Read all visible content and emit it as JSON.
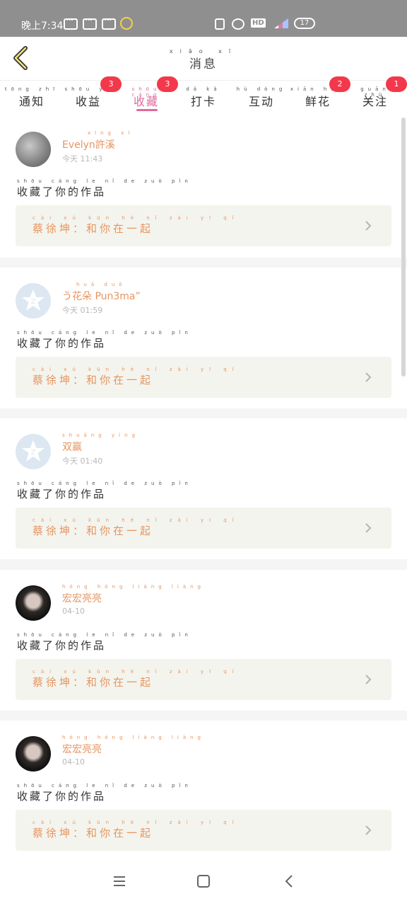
{
  "status_bar": {
    "time": "晚上7:34",
    "hd": "HD",
    "battery": "17"
  },
  "header": {
    "title_pinyin": "xiāo xī",
    "title": "消息"
  },
  "tabs": [
    {
      "pinyin": "tōng zhī",
      "label": "通知",
      "badge": ""
    },
    {
      "pinyin": "shōu yì",
      "label": "收益",
      "badge": "3"
    },
    {
      "pinyin": "shōu cáng",
      "label": "收藏",
      "badge": "3"
    },
    {
      "pinyin": "dǎ kǎ",
      "label": "打卡",
      "badge": ""
    },
    {
      "pinyin": "hù dòng",
      "label": "互动",
      "badge": ""
    },
    {
      "pinyin": "xiān huā",
      "label": "鲜花",
      "badge": "2"
    },
    {
      "pinyin": "guān zhù",
      "label": "关注",
      "badge": "1"
    }
  ],
  "messages": [
    {
      "name_pinyin": "xīng xī",
      "name": "Evelyn許溪",
      "time": "今天 11:43",
      "action_pinyin": "shōu cáng le nǐ de zuò pǐn",
      "action": "收藏了你的作品",
      "work_pinyin": "cài xú kūn hé nǐ zài yī qǐ",
      "work": "蔡徐坤：和你在一起"
    },
    {
      "name_pinyin": "huā duǒ",
      "name": "う花朵 Pun3ma”",
      "time": "今天 01:59",
      "action_pinyin": "shōu cáng le nǐ de zuò pǐn",
      "action": "收藏了你的作品",
      "work_pinyin": "cài xú kūn hé nǐ zài yī qǐ",
      "work": "蔡徐坤：和你在一起"
    },
    {
      "name_pinyin": "shuāng yíng",
      "name": "双赢",
      "time": "今天 01:40",
      "action_pinyin": "shōu cáng le nǐ de zuò pǐn",
      "action": "收藏了你的作品",
      "work_pinyin": "cài xú kūn hé nǐ zài yī qǐ",
      "work": "蔡徐坤：和你在一起"
    },
    {
      "name_pinyin": "hóng hóng liàng liàng",
      "name": "宏宏亮亮",
      "time": "04-10",
      "action_pinyin": "shōu cáng le nǐ de zuò pǐn",
      "action": "收藏了你的作品",
      "work_pinyin": "cài xú kūn hé nǐ zài yī qǐ",
      "work": "蔡徐坤：和你在一起"
    },
    {
      "name_pinyin": "hóng hóng liàng liàng",
      "name": "宏宏亮亮",
      "time": "04-10",
      "action_pinyin": "shōu cáng le nǐ de zuò pǐn",
      "action": "收藏了你的作品",
      "work_pinyin": "cài xú kūn hé nǐ zài yī qǐ",
      "work": "蔡徐坤：和你在一起"
    }
  ],
  "colors": {
    "accent": "#e06a9a",
    "badge": "#f3384b",
    "username": "#e69560",
    "work_bg": "#f4f4ee"
  }
}
